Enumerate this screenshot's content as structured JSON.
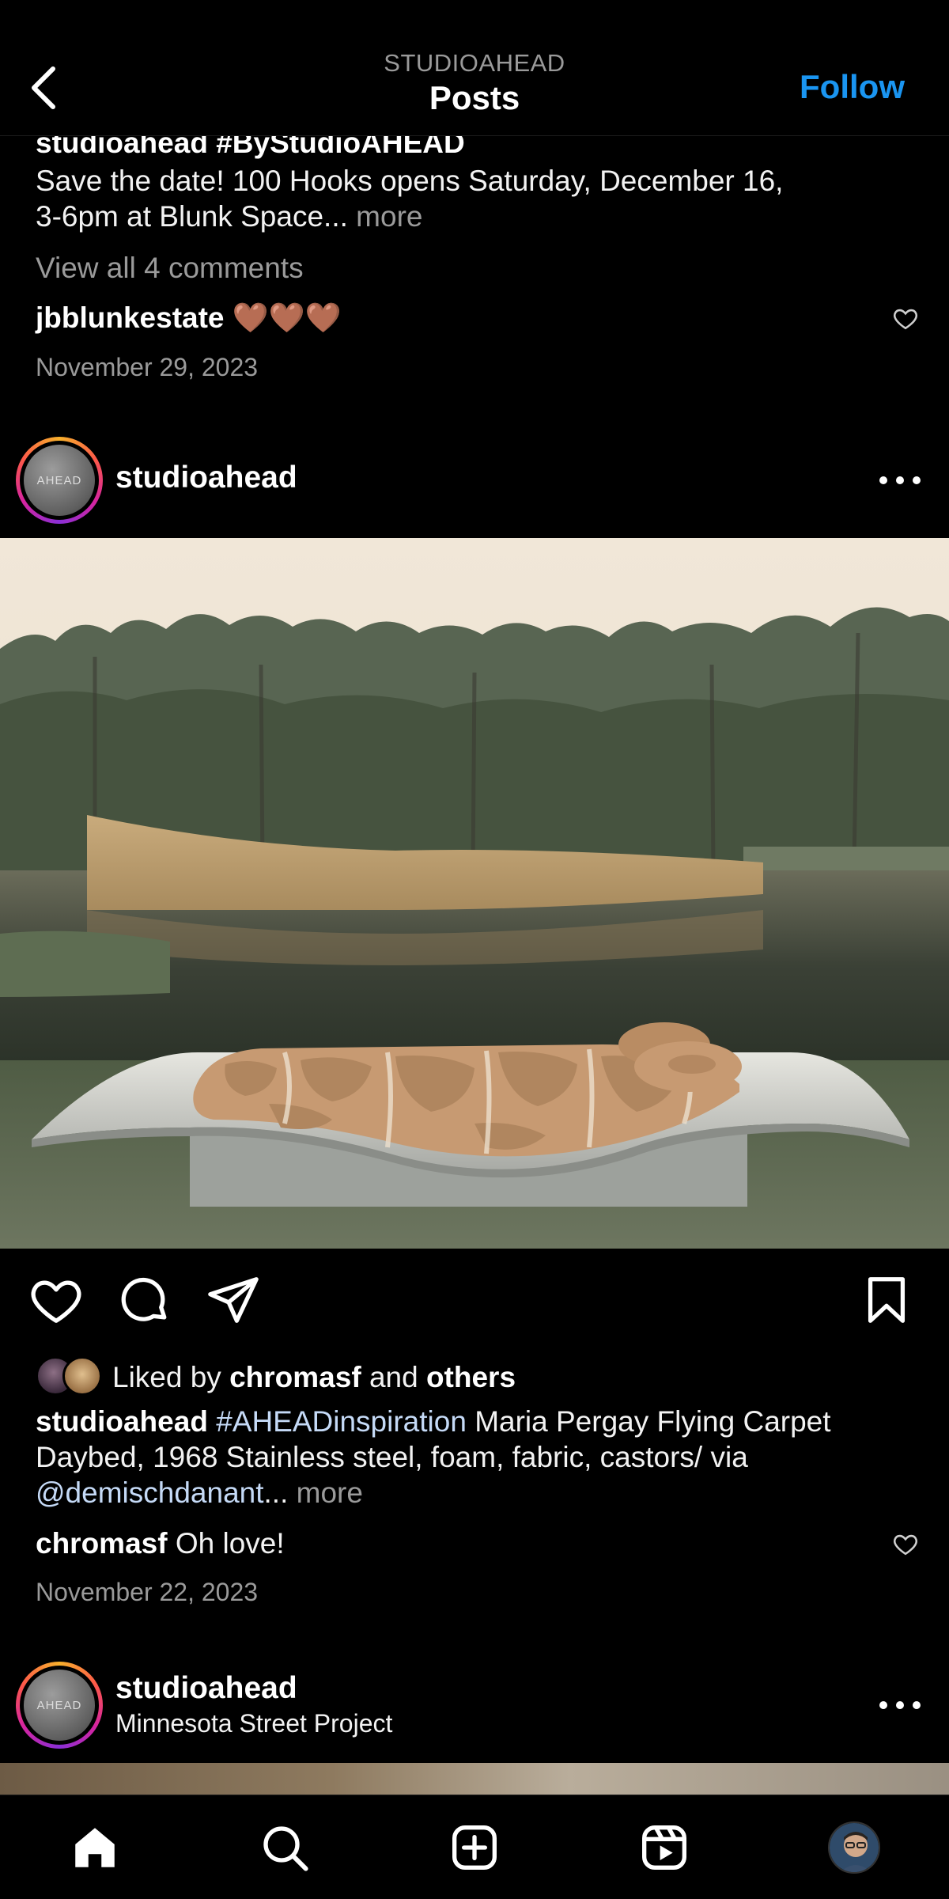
{
  "header": {
    "handle": "STUDIOAHEAD",
    "title": "Posts",
    "follow_label": "Follow"
  },
  "prev_post": {
    "caption_partial": "studioahead #ByStudioAHEAD",
    "caption_line1": "Save the date! 100 Hooks opens Saturday, December 16,",
    "caption_line2": "3-6pm at Blunk Space...",
    "more_label": "more",
    "view_comments": "View all 4 comments",
    "comment": {
      "user": "jbblunkestate",
      "text": "🤎🤎🤎"
    },
    "date": "November 29, 2023"
  },
  "post": {
    "username": "studioahead",
    "avatar_text": "AHEAD",
    "liked_by_prefix": "Liked by",
    "liked_by_user": "chromasf",
    "liked_by_and": "and",
    "liked_by_others": "others",
    "caption_user": "studioahead",
    "caption_hashtag": "#AHEADinspiration",
    "caption_line1_rest": "Maria Pergay Flying Carpet",
    "caption_line2": "Daybed, 1968 Stainless steel, foam, fabric, castors/  via",
    "caption_mention": "@demischdanant",
    "caption_ellipsis": "...",
    "more_label": "more",
    "comment": {
      "user": "chromasf",
      "text": "Oh love!"
    },
    "date": "November 22, 2023"
  },
  "next_post": {
    "username": "studioahead",
    "location": "Minnesota Street Project",
    "avatar_text": "AHEAD"
  },
  "icons": {
    "back": "chevron-left-icon",
    "more": "more-dots-icon",
    "like": "heart-icon",
    "comment": "comment-bubble-icon",
    "share": "paper-plane-icon",
    "save": "bookmark-icon",
    "home": "home-icon",
    "search": "search-icon",
    "create": "plus-square-icon",
    "reels": "reels-icon",
    "profile": "profile-avatar"
  },
  "colors": {
    "background": "#000000",
    "accent": "#1a95f1",
    "hashtag": "#c5daf7",
    "muted": "#9a9a9a"
  }
}
